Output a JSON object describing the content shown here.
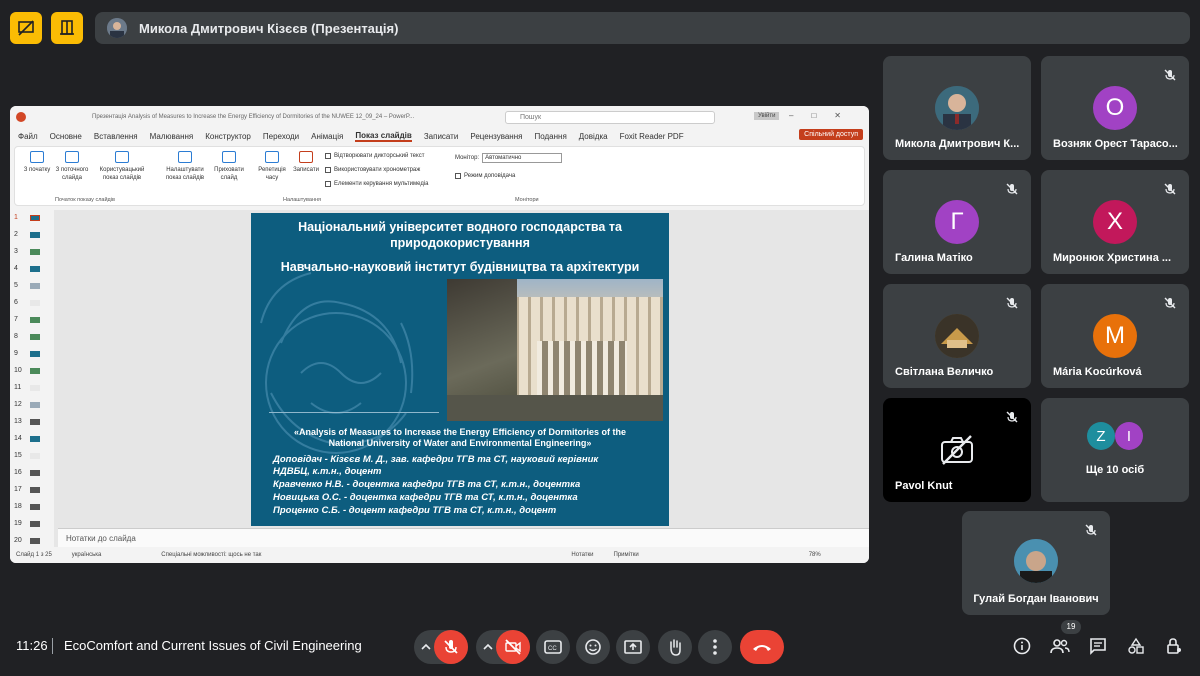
{
  "presenter": {
    "name": "Микола Дмитрович Кізєєв (Презентація)"
  },
  "powerpoint": {
    "title_bar": "Презентація Analysis of Measures to Increase the Energy Efficiency of Dormitories of the NUWEE 12_09_24 – PowerP...",
    "search_placeholder": "Пошук",
    "user": "Увійти",
    "menu": [
      "Файл",
      "Основне",
      "Вставлення",
      "Малювання",
      "Конструктор",
      "Переходи",
      "Анімація",
      "Показ слайдів",
      "Записати",
      "Рецензування",
      "Подання",
      "Довідка",
      "Foxit Reader PDF"
    ],
    "active_menu": "Показ слайдів",
    "share_button": "Спільний доступ",
    "ribbon": {
      "from_start": "З початку",
      "from_current": "З поточного слайда",
      "custom_show": "Користувацький показ слайдів",
      "setup_show": "Налаштувати показ слайдів",
      "hide_slide": "Приховати слайд",
      "rehearse": "Репетиція часу",
      "record": "Записати",
      "chk_narration": "Відтворювати дикторський текст",
      "chk_timings": "Використовувати хронометраж",
      "chk_media": "Елементи керування мультимедіа",
      "monitor_label": "Монітор:",
      "monitor_value": "Автоматично",
      "presenter_view": "Режим доповідача",
      "group_start": "Початок показу слайдів",
      "group_setup": "Налаштування",
      "group_monitors": "Монітори"
    },
    "slide_numbers": [
      "1",
      "2",
      "3",
      "4",
      "5",
      "6",
      "7",
      "8",
      "9",
      "10",
      "11",
      "12",
      "13",
      "14",
      "15",
      "16",
      "17",
      "18",
      "19",
      "20"
    ],
    "notes_placeholder": "Нотатки до слайда",
    "status": {
      "slide": "Слайд 1 з 25",
      "lang": "українська",
      "accessibility": "Спеціальні можливості: щось не так",
      "notes": "Нотатки",
      "comments": "Примітки",
      "zoom": "78%"
    },
    "slide": {
      "line1": "Національний університет водного господарства та",
      "line2": "природокористування",
      "line3": "Навчально-науковий інститут будівництва та архітектури",
      "sub1": "«Analysis of Measures to Increase the Energy Efficiency of Dormitories of the",
      "sub2": "National University of Water and Environmental Engineering»",
      "auth1": "Доповідач - Кізєєв М. Д., зав. кафедри ТГВ та СТ, науковий керівник",
      "auth2": "НДВБЦ, к.т.н., доцент",
      "auth3": "Кравченко Н.В. - доцентка кафедри ТГВ та СТ, к.т.н., доцентка",
      "auth4": "Новицька О.С. - доцентка кафедри ТГВ та СТ, к.т.н., доцентка",
      "auth5": "Проценко С.Б. - доцент кафедри ТГВ та СТ, к.т.н., доцент"
    }
  },
  "participants": [
    {
      "name": "Микола Дмитрович К...",
      "avatar": "photo",
      "color": "#4a5a6a"
    },
    {
      "name": "Возняк Орест Тарасо...",
      "avatar": "О",
      "color": "#a142c4"
    },
    {
      "name": "Галина Матіко",
      "avatar": "Г",
      "color": "#a142c4"
    },
    {
      "name": "Миронюк Христина ...",
      "avatar": "Х",
      "color": "#c2185b"
    },
    {
      "name": "Світлана Величко",
      "avatar": "photo",
      "color": "#6b5a3a"
    },
    {
      "name": "Mária Kocúrková",
      "avatar": "M",
      "color": "#e8710a"
    },
    {
      "name": "Pavol Knut",
      "avatar": "camera-off",
      "color": "#000000"
    },
    {
      "name": "Ще 10 осіб",
      "avatar_a": "Z",
      "avatar_b": "I",
      "color_a": "#1e8e9e",
      "color_b": "#a142c4"
    },
    {
      "name": "Гулай Богдан Іванович",
      "avatar": "photo",
      "color": "#3a6a8a"
    }
  ],
  "bottom_bar": {
    "time": "11:26",
    "meeting_title": "EcoComfort and Current Issues of Civil Engineering",
    "participant_count": "19"
  },
  "colors": {
    "accent": "#fbbc04",
    "danger": "#ea4335",
    "tile": "#3c4043",
    "slide_bg": "#0d5d7f"
  }
}
